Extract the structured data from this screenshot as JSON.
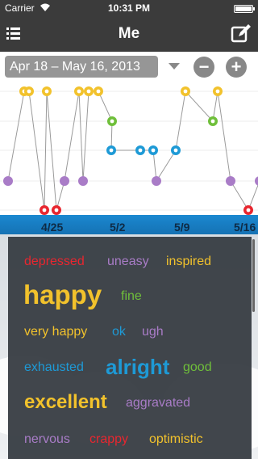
{
  "status": {
    "carrier": "Carrier",
    "time": "10:31 PM"
  },
  "nav": {
    "title": "Me"
  },
  "range": {
    "label": "Apr 18 – May 16, 2013"
  },
  "chart_data": {
    "type": "line",
    "x_ticks": [
      "4/25",
      "5/2",
      "5/9",
      "5/16"
    ],
    "grid": true,
    "series": [
      {
        "points": [
          {
            "x": 10,
            "level": 4,
            "color": "#a97cc7"
          },
          {
            "x": 30,
            "level": 0,
            "color": "#f2c22c"
          },
          {
            "x": 36,
            "level": 0,
            "color": "#f2c22c"
          },
          {
            "x": 55,
            "level": 6,
            "color": "#e8262f"
          },
          {
            "x": 58,
            "level": 0,
            "color": "#f2c22c"
          },
          {
            "x": 70,
            "level": 6,
            "color": "#e8262f"
          },
          {
            "x": 80,
            "level": 4,
            "color": "#a97cc7"
          },
          {
            "x": 98,
            "level": 0,
            "color": "#f2c22c"
          },
          {
            "x": 103,
            "level": 4,
            "color": "#a97cc7"
          },
          {
            "x": 110,
            "level": 0,
            "color": "#f2c22c"
          },
          {
            "x": 122,
            "level": 0,
            "color": "#f2c22c"
          },
          {
            "x": 139,
            "level": 1,
            "color": "#6fbf3a"
          },
          {
            "x": 138,
            "level": 2,
            "color": "#1e9ad6"
          },
          {
            "x": 174,
            "level": 2,
            "color": "#1e9ad6"
          },
          {
            "x": 190,
            "level": 2,
            "color": "#1e9ad6"
          },
          {
            "x": 194,
            "level": 4,
            "color": "#a97cc7"
          },
          {
            "x": 218,
            "level": 2,
            "color": "#1e9ad6"
          },
          {
            "x": 230,
            "level": 0,
            "color": "#f2c22c"
          },
          {
            "x": 264,
            "level": 1,
            "color": "#6fbf3a"
          },
          {
            "x": 270,
            "level": 0,
            "color": "#f2c22c"
          },
          {
            "x": 286,
            "level": 4,
            "color": "#a97cc7"
          },
          {
            "x": 308,
            "level": 6,
            "color": "#e8262f"
          },
          {
            "x": 322,
            "level": 4,
            "color": "#a97cc7"
          }
        ]
      }
    ]
  },
  "words": [
    {
      "text": "depressed",
      "color": "#e8262f",
      "size": 16
    },
    {
      "text": "uneasy",
      "color": "#a97cc7",
      "size": 16
    },
    {
      "text": "inspired",
      "color": "#f2c22c",
      "size": 16
    },
    {
      "text": "happy",
      "color": "#f2c22c",
      "size": 33
    },
    {
      "text": "fine",
      "color": "#6fbf3a",
      "size": 16
    },
    {
      "text": "very happy",
      "color": "#f2c22c",
      "size": 16
    },
    {
      "text": "ok",
      "color": "#1e9ad6",
      "size": 16
    },
    {
      "text": "ugh",
      "color": "#a97cc7",
      "size": 16
    },
    {
      "text": "exhausted",
      "color": "#1e9ad6",
      "size": 16
    },
    {
      "text": "alright",
      "color": "#1e9ad6",
      "size": 26
    },
    {
      "text": "good",
      "color": "#6fbf3a",
      "size": 16
    },
    {
      "text": "excellent",
      "color": "#f2c22c",
      "size": 24
    },
    {
      "text": "aggravated",
      "color": "#a97cc7",
      "size": 16
    },
    {
      "text": "nervous",
      "color": "#a97cc7",
      "size": 16
    },
    {
      "text": "crappy",
      "color": "#e8262f",
      "size": 16
    },
    {
      "text": "optimistic",
      "color": "#f2c22c",
      "size": 16
    }
  ]
}
